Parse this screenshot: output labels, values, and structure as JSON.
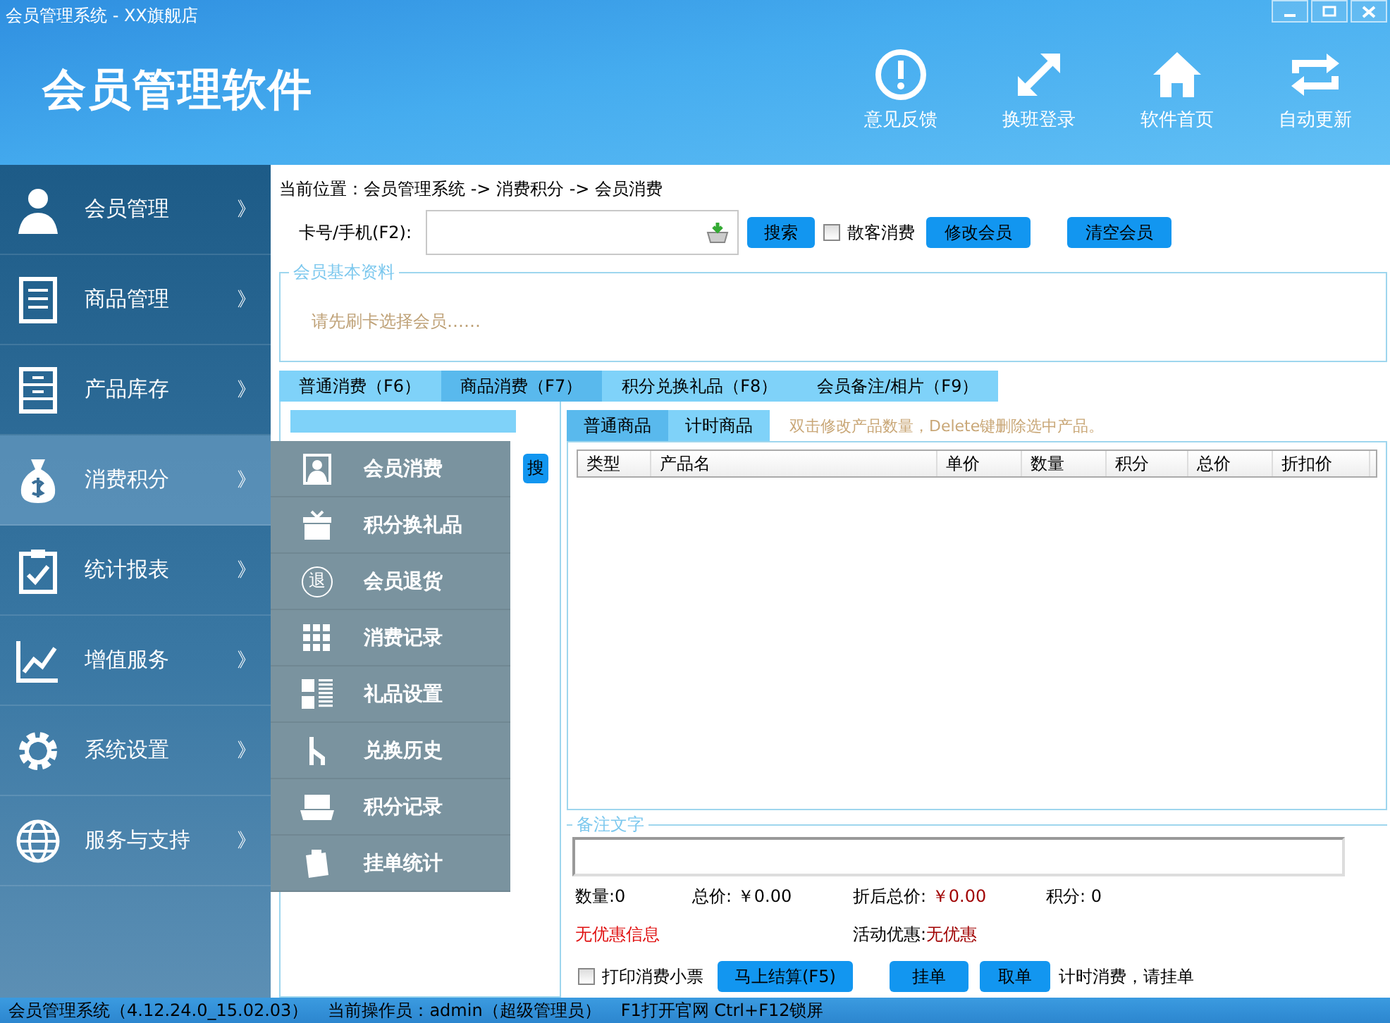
{
  "window": {
    "title": "会员管理系统 - XX旗舰店"
  },
  "header": {
    "app_name": "会员管理软件",
    "actions": [
      {
        "kind": "feedback",
        "label": "意见反馈"
      },
      {
        "kind": "switch",
        "label": "换班登录"
      },
      {
        "kind": "home",
        "label": "软件首页"
      },
      {
        "kind": "update",
        "label": "自动更新"
      }
    ]
  },
  "sidebar": {
    "items": [
      {
        "kind": "member",
        "label": "会员管理",
        "arrow": "》",
        "selected": false
      },
      {
        "kind": "goods",
        "label": "商品管理",
        "arrow": "》",
        "selected": false
      },
      {
        "kind": "stock",
        "label": "产品库存",
        "arrow": "》",
        "selected": false
      },
      {
        "kind": "money",
        "label": "消费积分",
        "arrow": "》",
        "selected": true
      },
      {
        "kind": "report",
        "label": "统计报表",
        "arrow": "》",
        "selected": false
      },
      {
        "kind": "chart",
        "label": "增值服务",
        "arrow": "》",
        "selected": false
      },
      {
        "kind": "gear",
        "label": "系统设置",
        "arrow": "》",
        "selected": false
      },
      {
        "kind": "globe",
        "label": "服务与支持",
        "arrow": "》",
        "selected": false
      }
    ]
  },
  "flyout_menu": {
    "items": [
      {
        "kind": "portrait",
        "label": "会员消费"
      },
      {
        "kind": "gift",
        "label": "积分换礼品"
      },
      {
        "kind": "return",
        "label": "会员退货",
        "icon_text": "退"
      },
      {
        "kind": "grid",
        "label": "消费记录"
      },
      {
        "kind": "list",
        "label": "礼品设置"
      },
      {
        "kind": "fork",
        "label": "兑换历史"
      },
      {
        "kind": "tray",
        "label": "积分记录"
      },
      {
        "kind": "clip",
        "label": "挂单统计"
      }
    ]
  },
  "breadcrumb": "当前位置：会员管理系统 -> 消费积分 -> 会员消费",
  "search": {
    "label": "卡号/手机(F2):",
    "button": "搜索",
    "checkbox": {
      "label": "散客消费",
      "checked": false
    },
    "buttons": [
      "修改会员",
      "清空会员"
    ]
  },
  "member_info": {
    "legend": "会员基本资料",
    "hint": "请先刷卡选择会员……"
  },
  "tabs": [
    {
      "label": "普通消费（F6）",
      "selected": false
    },
    {
      "label": "商品消费（F7）",
      "selected": true
    },
    {
      "label": "积分兑换礼品（F8）",
      "selected": false
    },
    {
      "label": "会员备注/相片（F9）",
      "selected": false
    }
  ],
  "left_panel": {
    "search_button": "搜"
  },
  "product_tabs": [
    {
      "label": "普通商品",
      "selected": true
    },
    {
      "label": "计时商品",
      "selected": false
    }
  ],
  "product_hint": "双击修改产品数量，Delete键删除选中产品。",
  "table": {
    "columns": [
      "类型",
      "产品名",
      "单价",
      "数量",
      "积分",
      "总价",
      "折扣价"
    ]
  },
  "remark": {
    "legend": "备注文字"
  },
  "summary": {
    "quantity": "数量:0",
    "total_label": "总价:",
    "total": "￥0.00",
    "discount_total_label": "折后总价:",
    "discount_total": "￥0.00",
    "points": "积分: 0",
    "no_discount": "无优惠信息",
    "promo_label": "活动优惠:",
    "promo": "无优惠"
  },
  "actions": {
    "print_checkbox": {
      "label": "打印消费小票",
      "checked": false
    },
    "checkout": "马上结算(F5)",
    "hold": "挂单",
    "retrieve": "取单",
    "note": "计时消费，请挂单"
  },
  "status_bar": [
    "会员管理系统（4.12.24.0_15.02.03）",
    "当前操作员：admin（超级管理员）",
    "F1打开官网 Ctrl+F12锁屏"
  ]
}
